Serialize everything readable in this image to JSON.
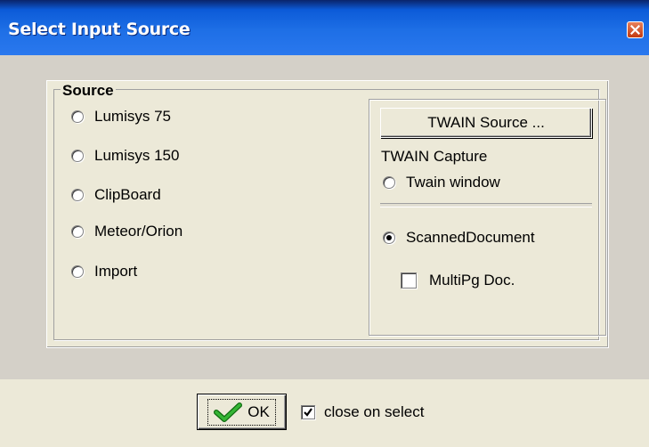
{
  "window": {
    "title": "Select Input Source",
    "close_icon": "close-icon"
  },
  "colors": {
    "titlebar": "#0c5bd8",
    "dialog_bg": "#ece9d8",
    "content_bg": "#d4d0c8",
    "close_button": "#d9541d",
    "ok_check": "#1f9a1f"
  },
  "source": {
    "label": "Source",
    "options": [
      {
        "label": "Lumisys 75",
        "checked": false
      },
      {
        "label": "Lumisys 150",
        "checked": false
      },
      {
        "label": "ClipBoard",
        "checked": false
      },
      {
        "label": "Meteor/Orion",
        "checked": false
      },
      {
        "label": "Import",
        "checked": false
      }
    ]
  },
  "twain": {
    "source_button": "TWAIN Source ...",
    "capture_label": "TWAIN Capture",
    "options": [
      {
        "label": "Twain window",
        "checked": false
      },
      {
        "label": "ScannedDocument",
        "checked": true
      }
    ],
    "multipage": {
      "label": "MultiPg Doc.",
      "checked": false
    }
  },
  "footer": {
    "ok_label": "OK",
    "ok_icon": "checkmark-icon",
    "close_on_select": {
      "label": "close on select",
      "checked": true
    }
  }
}
